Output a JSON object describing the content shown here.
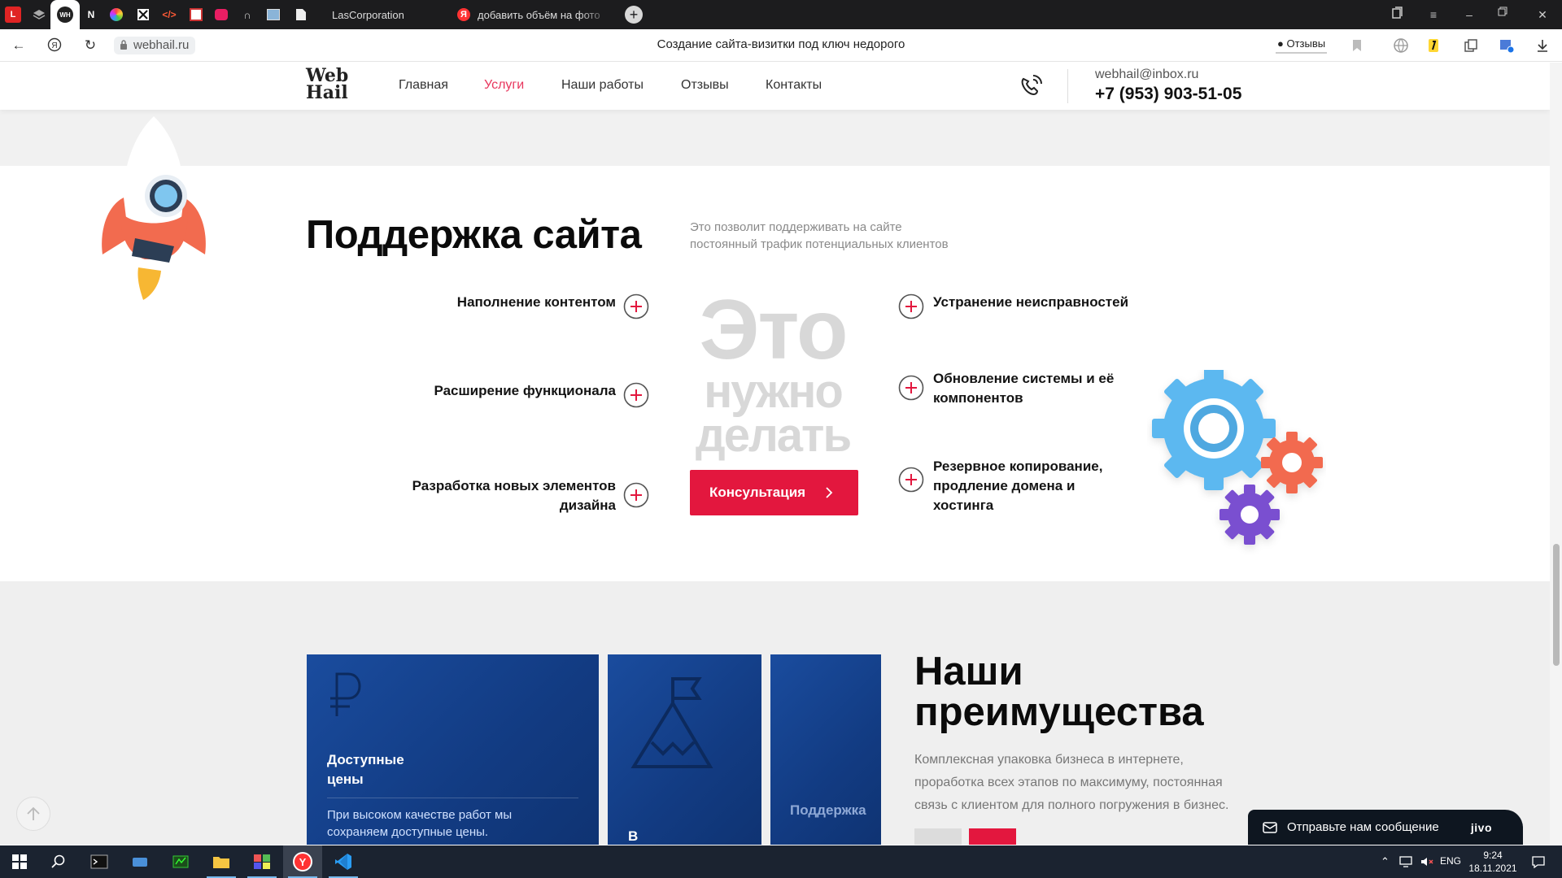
{
  "browser": {
    "tabs": [
      {
        "title": "LasCorporation"
      },
      {
        "title": "добавить объём на фото"
      }
    ],
    "url": "webhail.ru",
    "page_title": "Создание сайта-визитки под ключ недорого",
    "reviews_label": "Отзывы"
  },
  "site": {
    "logo_line1": "Web",
    "logo_line2": "Hail",
    "nav": [
      {
        "label": "Главная"
      },
      {
        "label": "Услуги",
        "active": true
      },
      {
        "label": "Наши работы"
      },
      {
        "label": "Отзывы"
      },
      {
        "label": "Контакты"
      }
    ],
    "email": "webhail@inbox.ru",
    "phone": "+7 (953) 903-51-05"
  },
  "support": {
    "title": "Поддержка сайта",
    "subtitle_line1": "Это позволит поддерживать на сайте",
    "subtitle_line2": "постоянный трафик потенциальных клиентов",
    "left_items": [
      {
        "line1": "Наполнение контентом"
      },
      {
        "line1": "Расширение функционала"
      },
      {
        "line1": "Разработка новых элементов",
        "line2": "дизайна"
      }
    ],
    "right_items": [
      {
        "line1": "Устранение неисправностей"
      },
      {
        "line1": "Обновление системы и её",
        "line2": "компонентов"
      },
      {
        "line1": "Резервное копирование,",
        "line2": "продление домена и",
        "line3": "хостинга"
      }
    ],
    "big_word_line1": "Это",
    "big_word_line2": "нужно",
    "big_word_line3": "делать",
    "consult_label": "Консультация"
  },
  "advantages": {
    "title_line1": "Наши",
    "title_line2": "преимущества",
    "desc_line1": "Комплексная упаковка бизнеса в интернете,",
    "desc_line2": "проработка всех этапов по максимуму, постоянная",
    "desc_line3": "связь с клиентом для полного погружения в бизнес.",
    "cards": [
      {
        "title_line1": "Доступные",
        "title_line2": "цены",
        "text_line1": "При высоком качестве работ мы",
        "text_line2": "сохраняем доступные цены."
      },
      {
        "title_line1": "В"
      },
      {
        "title_line1": "Поддержка"
      }
    ]
  },
  "chat": {
    "label": "Отправьте нам сообщение",
    "brand": "jivo"
  },
  "taskbar": {
    "lang": "ENG",
    "time": "9:24",
    "date": "18.11.2021"
  },
  "colors": {
    "accent_red": "#e3173e",
    "nav_active": "#e8365d",
    "card_blue": "#1a4a98"
  }
}
